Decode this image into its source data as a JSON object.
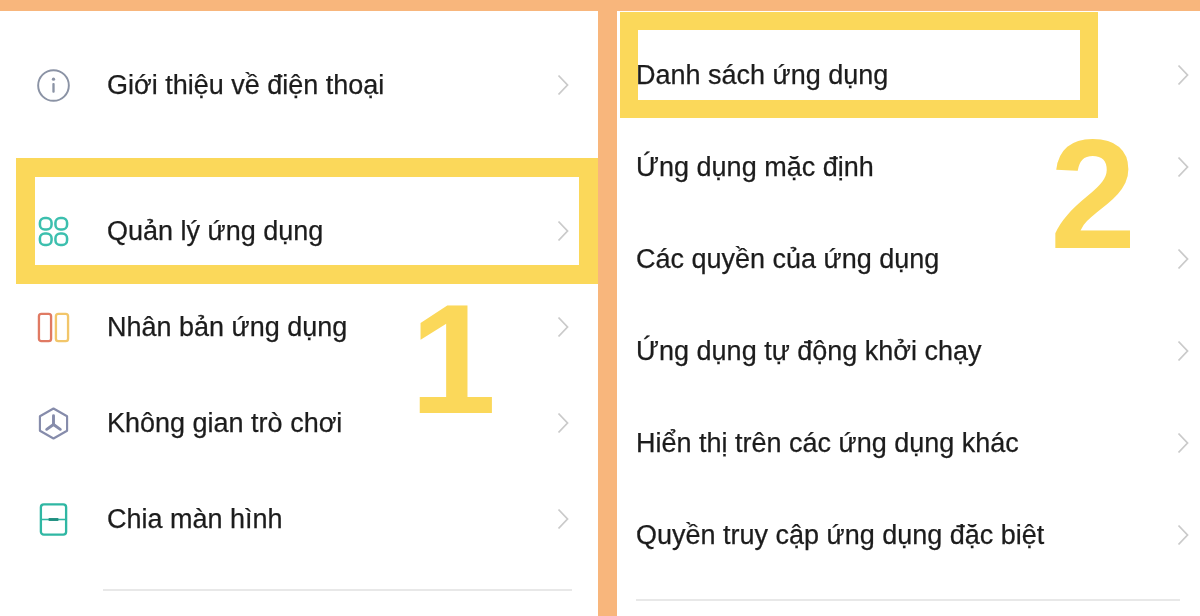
{
  "left_panel": {
    "step_number": "1",
    "sections": [
      {
        "items": [
          {
            "label": "Giới thiệu về điện thoại",
            "highlighted": false
          }
        ]
      },
      {
        "items": [
          {
            "label": "Quản lý ứng dụng",
            "highlighted": true
          },
          {
            "label": "Nhân bản ứng dụng",
            "highlighted": false
          },
          {
            "label": "Không gian trò chơi",
            "highlighted": false
          },
          {
            "label": "Chia màn hình",
            "highlighted": false
          }
        ]
      }
    ]
  },
  "right_panel": {
    "step_number": "2",
    "items": [
      {
        "label": "Danh sách ứng dụng",
        "highlighted": true
      },
      {
        "label": "Ứng dụng mặc định",
        "highlighted": false
      },
      {
        "label": "Các quyền của ứng dụng",
        "highlighted": false
      },
      {
        "label": "Ứng dụng tự động khởi chạy",
        "highlighted": false
      },
      {
        "label": "Hiển thị trên các ứng dụng khác",
        "highlighted": false
      },
      {
        "label": "Quyền truy cập ứng dụng đặc biệt",
        "highlighted": false
      }
    ]
  }
}
